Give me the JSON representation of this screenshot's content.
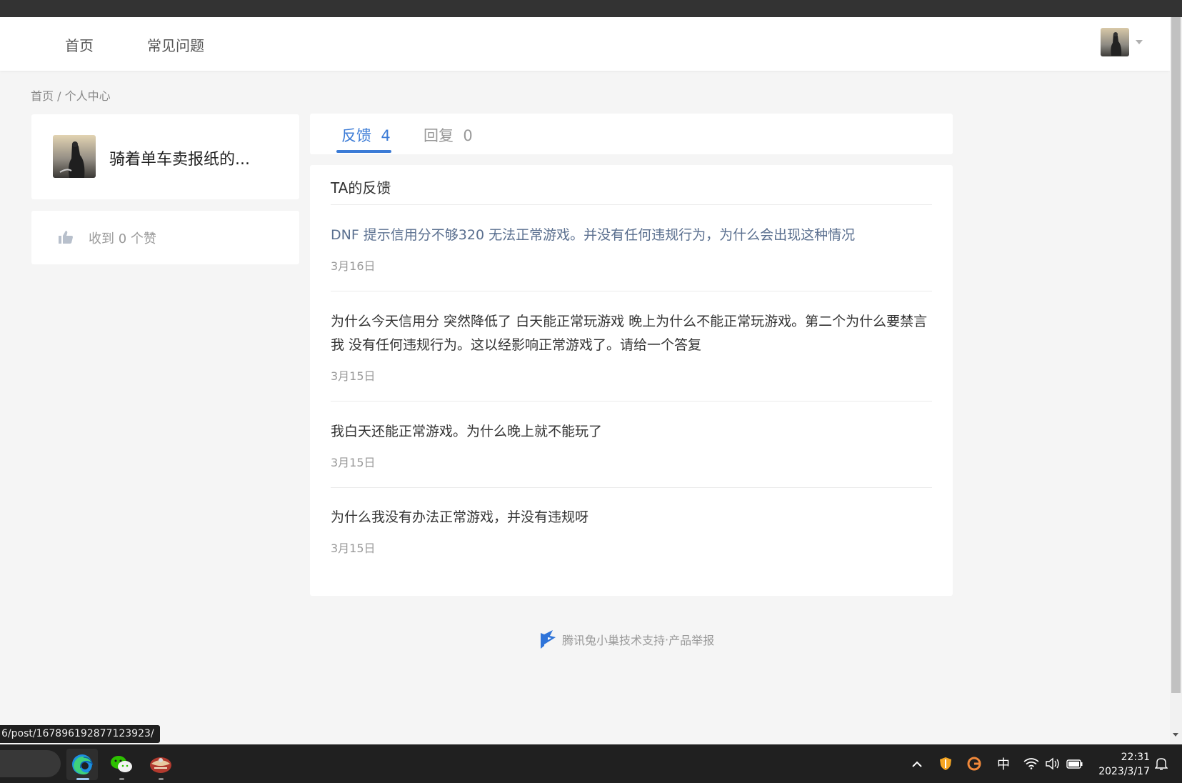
{
  "header": {
    "nav": [
      "首页",
      "常见问题"
    ]
  },
  "breadcrumb": {
    "home": "首页",
    "sep": " / ",
    "current": "个人中心"
  },
  "profile": {
    "name": "骑着单车卖报纸的...",
    "likes": "收到 0 个赞"
  },
  "tabs": [
    {
      "label": "反馈",
      "count": "4",
      "active": true
    },
    {
      "label": "回复",
      "count": "0",
      "active": false
    }
  ],
  "list": {
    "title": "TA的反馈",
    "posts": [
      {
        "text": "DNF 提示信用分不够320 无法正常游戏。并没有任何违规行为，为什么会出现这种情况",
        "date": "3月16日"
      },
      {
        "text": "为什么今天信用分 突然降低了 白天能正常玩游戏 晚上为什么不能正常玩游戏。第二个为什么要禁言我 没有任何违规行为。这以经影响正常游戏了。请给一个答复",
        "date": "3月15日"
      },
      {
        "text": "我白天还能正常游戏。为什么晚上就不能玩了",
        "date": "3月15日"
      },
      {
        "text": "为什么我没有办法正常游戏，并没有违规呀",
        "date": "3月15日"
      }
    ]
  },
  "footer": {
    "support": "腾讯兔小巢技术支持",
    "dot": " · ",
    "report": "产品举报"
  },
  "status_url": "6/post/167896192877123923/",
  "taskbar": {
    "ime": "中",
    "time": "22:31",
    "date": "2023/3/17"
  },
  "colors": {
    "accent": "#3b7bd6",
    "visited_link": "#5a6f8f",
    "topbar": "#333333",
    "taskbar": "#202020"
  }
}
